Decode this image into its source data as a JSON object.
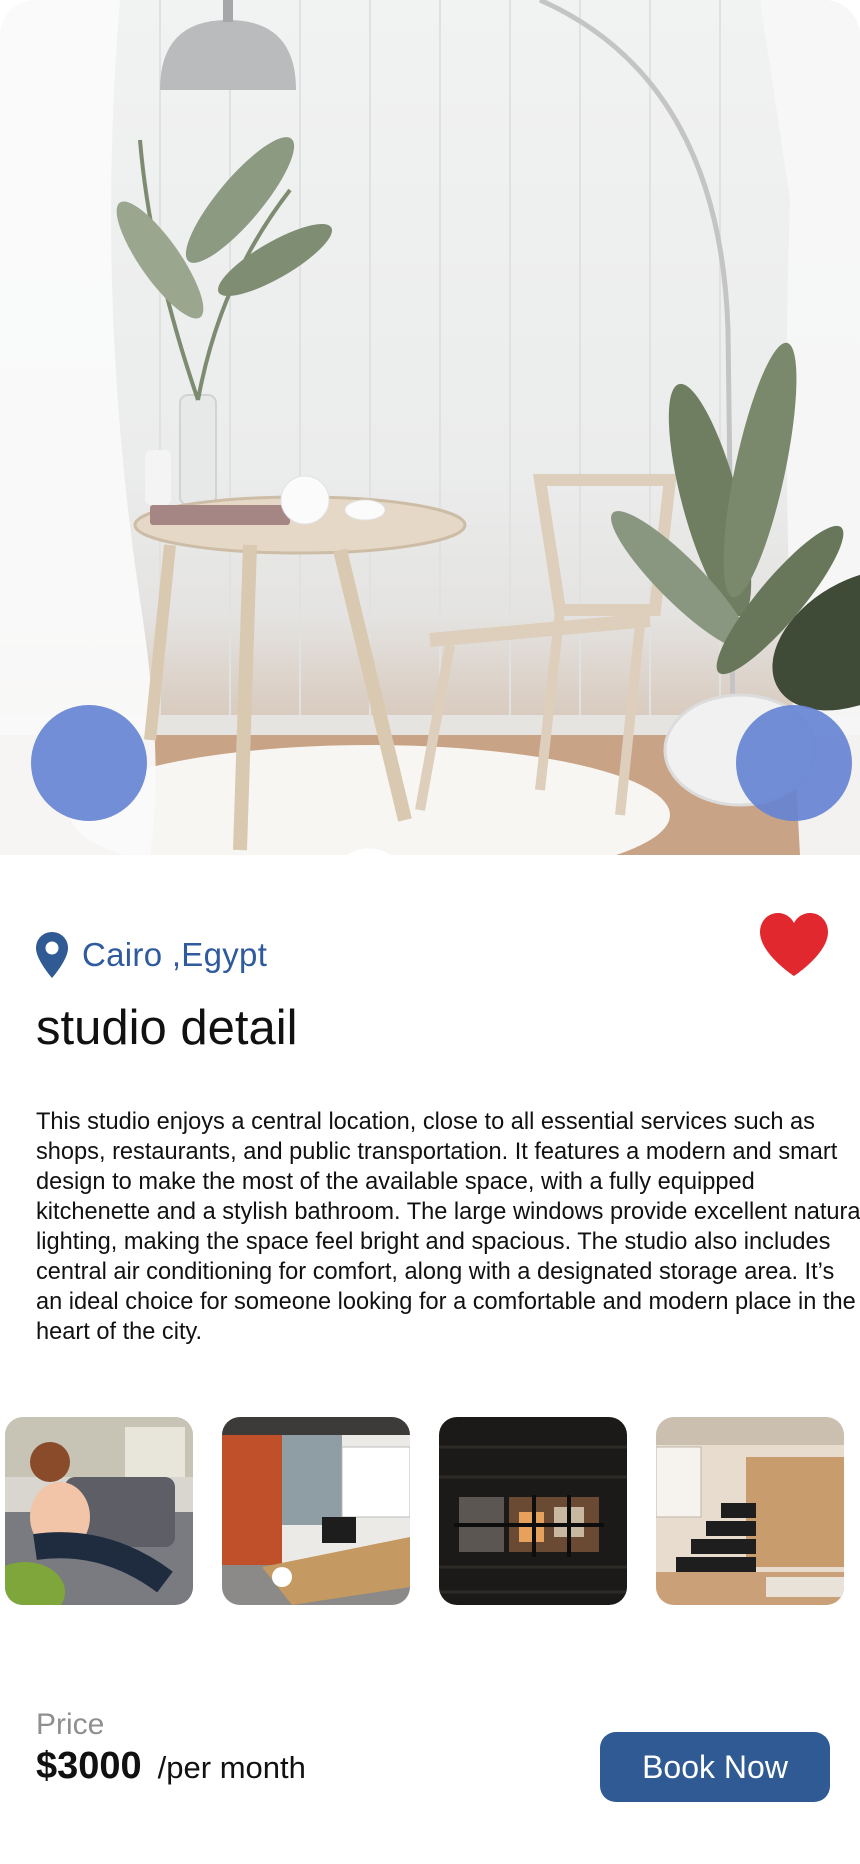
{
  "hero": {
    "image_icon": "studio-interior-photo",
    "prev_icon": "arrow-left-icon",
    "next_icon": "arrow-right-icon"
  },
  "listing": {
    "location": "Cairo ,Egypt",
    "location_icon": "map-pin-icon",
    "favorite_icon": "heart-icon",
    "favorited": true,
    "title": "studio detail",
    "description": "This studio enjoys a central location, close to all essential services such as shops, restaurants, and public transportation. It features a modern and smart design to make the most of the available space, with a fully equipped kitchenette and a stylish bathroom. The large windows provide excellent natural lighting, making the space feel bright and spacious. The studio also includes central air conditioning for comfort, along with a designated storage area. It’s an ideal choice for someone looking for a comfortable and modern place in the heart of the city."
  },
  "gallery": [
    {
      "icon": "woman-on-sofa-photo"
    },
    {
      "icon": "office-workspace-photo"
    },
    {
      "icon": "dark-brick-interior-photo"
    },
    {
      "icon": "loft-staircase-photo"
    }
  ],
  "booking": {
    "price_label": "Price",
    "price": "$3000",
    "period": "/per month",
    "book_label": "Book Now"
  },
  "colors": {
    "accent": "#2f5a93",
    "location_text": "#2f5a9e",
    "nav_button": "#6684d2",
    "heart": "#e0282e"
  }
}
